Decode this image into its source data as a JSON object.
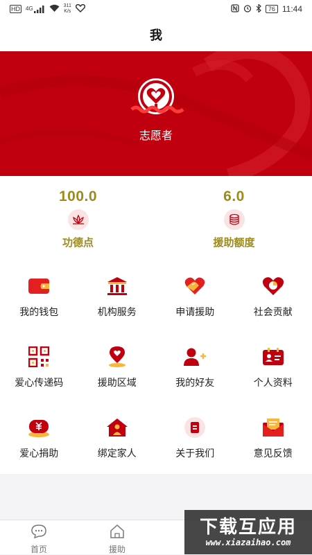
{
  "status_bar": {
    "left": {
      "hd": "HD",
      "signal": "4G",
      "speed_value": "311",
      "speed_unit": "K/s"
    },
    "right": {
      "battery": "76",
      "time": "11:44"
    }
  },
  "header": {
    "title": "我"
  },
  "profile": {
    "role": "志愿者",
    "username_redacted": true
  },
  "stats": [
    {
      "value": "100.0",
      "label": "功德点",
      "icon": "lotus-icon"
    },
    {
      "value": "6.0",
      "label": "援助额度",
      "icon": "coin-stack-icon"
    }
  ],
  "menu": [
    {
      "label": "我的钱包",
      "icon": "wallet-icon"
    },
    {
      "label": "机构服务",
      "icon": "institution-icon"
    },
    {
      "label": "申请援助",
      "icon": "heart-hands-icon"
    },
    {
      "label": "社会贡献",
      "icon": "heart-chart-icon"
    },
    {
      "label": "爱心传递码",
      "icon": "qr-code-icon"
    },
    {
      "label": "援助区域",
      "icon": "location-heart-icon"
    },
    {
      "label": "我的好友",
      "icon": "add-friend-icon"
    },
    {
      "label": "个人资料",
      "icon": "id-card-icon"
    },
    {
      "label": "爱心捐助",
      "icon": "donation-box-icon"
    },
    {
      "label": "绑定家人",
      "icon": "family-house-icon"
    },
    {
      "label": "关于我们",
      "icon": "about-document-icon"
    },
    {
      "label": "意见反馈",
      "icon": "feedback-mail-icon"
    }
  ],
  "tabs": [
    {
      "label": "首页",
      "icon": "chat-bubble-icon"
    },
    {
      "label": "援助",
      "icon": "house-icon"
    }
  ],
  "watermark": {
    "main": "下载互应用",
    "url": "www.xiazaihao.com"
  },
  "colors": {
    "primary": "#c1000f",
    "gold_text": "#9b8a1c",
    "icon_bg": "#fbe3e3"
  }
}
